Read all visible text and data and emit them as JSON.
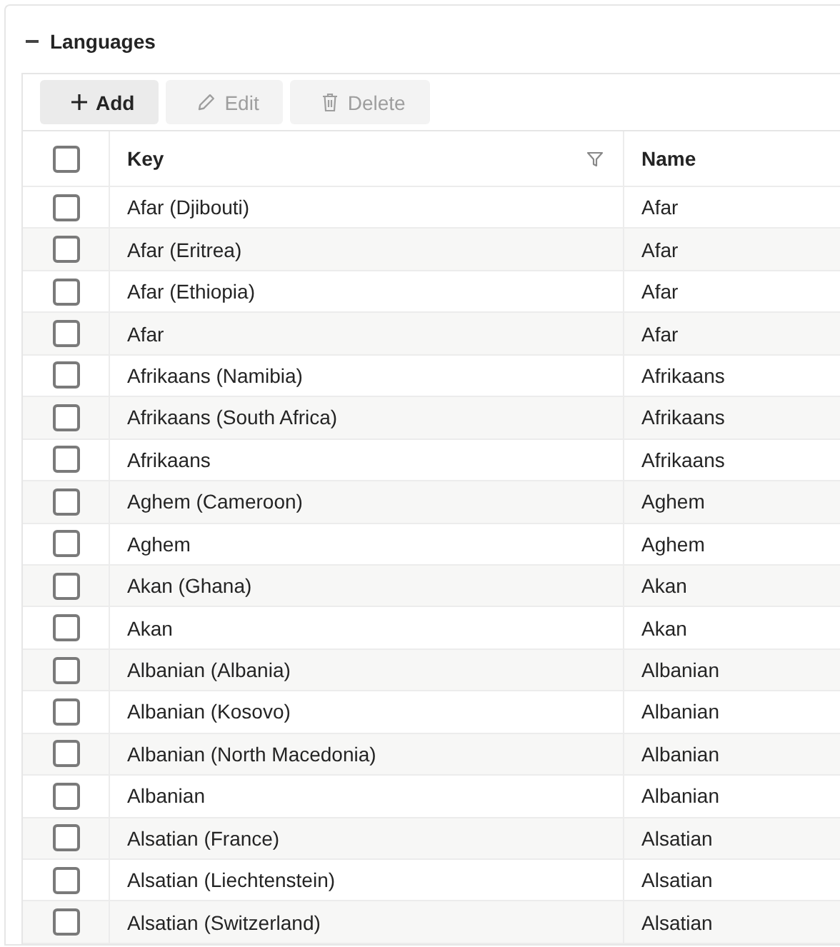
{
  "section": {
    "title": "Languages",
    "expanded": true
  },
  "toolbar": [
    {
      "kind": "add",
      "label": "Add",
      "disabled": false
    },
    {
      "kind": "edit",
      "label": "Edit",
      "disabled": true
    },
    {
      "kind": "delete",
      "label": "Delete",
      "disabled": true
    }
  ],
  "table": {
    "select_all": {
      "checked": false
    },
    "columns": [
      {
        "label": "Key",
        "filter": true
      },
      {
        "label": "Name",
        "filter": false
      }
    ],
    "rows": [
      {
        "checked": false,
        "cells": [
          "Afar (Djibouti)",
          "Afar"
        ]
      },
      {
        "checked": false,
        "cells": [
          "Afar (Eritrea)",
          "Afar"
        ]
      },
      {
        "checked": false,
        "cells": [
          "Afar (Ethiopia)",
          "Afar"
        ]
      },
      {
        "checked": false,
        "cells": [
          "Afar",
          "Afar"
        ]
      },
      {
        "checked": false,
        "cells": [
          "Afrikaans (Namibia)",
          "Afrikaans"
        ]
      },
      {
        "checked": false,
        "cells": [
          "Afrikaans (South Africa)",
          "Afrikaans"
        ]
      },
      {
        "checked": false,
        "cells": [
          "Afrikaans",
          "Afrikaans"
        ]
      },
      {
        "checked": false,
        "cells": [
          "Aghem (Cameroon)",
          "Aghem"
        ]
      },
      {
        "checked": false,
        "cells": [
          "Aghem",
          "Aghem"
        ]
      },
      {
        "checked": false,
        "cells": [
          "Akan (Ghana)",
          "Akan"
        ]
      },
      {
        "checked": false,
        "cells": [
          "Akan",
          "Akan"
        ]
      },
      {
        "checked": false,
        "cells": [
          "Albanian (Albania)",
          "Albanian"
        ]
      },
      {
        "checked": false,
        "cells": [
          "Albanian (Kosovo)",
          "Albanian"
        ]
      },
      {
        "checked": false,
        "cells": [
          "Albanian (North Macedonia)",
          "Albanian"
        ]
      },
      {
        "checked": false,
        "cells": [
          "Albanian",
          "Albanian"
        ]
      },
      {
        "checked": false,
        "cells": [
          "Alsatian (France)",
          "Alsatian"
        ]
      },
      {
        "checked": false,
        "cells": [
          "Alsatian (Liechtenstein)",
          "Alsatian"
        ]
      },
      {
        "checked": false,
        "cells": [
          "Alsatian (Switzerland)",
          "Alsatian"
        ]
      }
    ]
  }
}
